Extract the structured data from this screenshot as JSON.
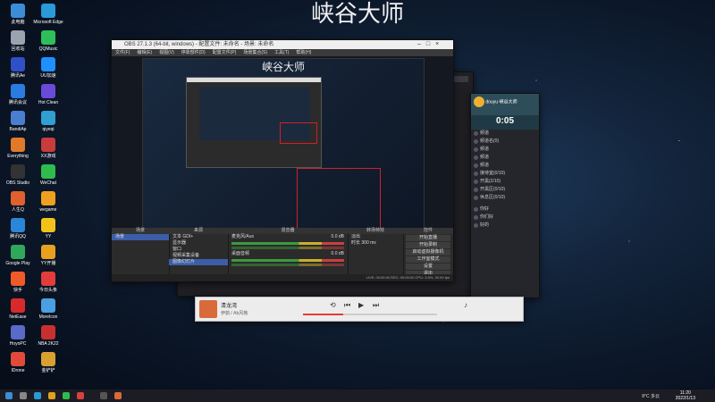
{
  "desktop_title": "峡谷大师",
  "desktop_icons": [
    {
      "label": "此电脑",
      "color": "#3c8dd8"
    },
    {
      "label": "Microsoft Edge",
      "color": "#2a9ad8"
    },
    {
      "label": "回收站",
      "color": "#9aa4b0"
    },
    {
      "label": "QQMusic",
      "color": "#2fbf5a"
    },
    {
      "label": "腾讯Ae",
      "color": "#3050c8"
    },
    {
      "label": "UU加速",
      "color": "#1e90ff"
    },
    {
      "label": "腾讯会议",
      "color": "#2a7ce0"
    },
    {
      "label": "Hot Clean",
      "color": "#6a4ad8"
    },
    {
      "label": "BandiAp",
      "color": "#4a7fd0"
    },
    {
      "label": "qiyeqi",
      "color": "#30a0d0"
    },
    {
      "label": "Everything",
      "color": "#e07a2a"
    },
    {
      "label": "XX游戏",
      "color": "#c83c3c"
    },
    {
      "label": "OBS Studio",
      "color": "#333333"
    },
    {
      "label": "WeChat",
      "color": "#2ebc4f"
    },
    {
      "label": "人生Q",
      "color": "#e06030"
    },
    {
      "label": "wegame",
      "color": "#f0a020"
    },
    {
      "label": "腾讯QQ",
      "color": "#2a86d8"
    },
    {
      "label": "YY",
      "color": "#f2c21b"
    },
    {
      "label": "Google Play",
      "color": "#2fa85a"
    },
    {
      "label": "YY开播",
      "color": "#e8a020"
    },
    {
      "label": "快手",
      "color": "#f05a28"
    },
    {
      "label": "今日头条",
      "color": "#e23c3c"
    },
    {
      "label": "NetEase",
      "color": "#d82a2a"
    },
    {
      "label": "MoreIcon",
      "color": "#4aa0e0"
    },
    {
      "label": "HoyoPC",
      "color": "#5a6ac8"
    },
    {
      "label": "NBA 2K22",
      "color": "#c83030"
    },
    {
      "label": "IDrone",
      "color": "#e04a3a"
    },
    {
      "label": "金铲铲",
      "color": "#d8a030"
    }
  ],
  "obs": {
    "title": "OBS 27.1.3 (64-bit, windows) - 配置文件: 未命名 - 场景: 未命名",
    "menu": [
      "文件(F)",
      "编辑(E)",
      "视图(V)",
      "停靠部件(D)",
      "配置文件(P)",
      "场景集合(S)",
      "工具(T)",
      "帮助(H)"
    ],
    "tabs": [
      "游戏捕获",
      "属性",
      "滤镜"
    ],
    "scene_title": "峡谷大师",
    "scenes_header": "场景",
    "scenes": [
      "场景"
    ],
    "sources_header": "来源",
    "sources": [
      "文本 GDI+",
      "显示器",
      "窗口",
      "视频采集设备",
      "图像幻灯片"
    ],
    "mixer_header": "混音器",
    "mixer": [
      {
        "name": "麦克风/Aux",
        "db": "0.0 dB"
      },
      {
        "name": "桌面音频",
        "db": "0.0 dB"
      }
    ],
    "transitions_header": "转场特效",
    "transition": "淡出",
    "duration_label": "时长",
    "duration": "300 ms",
    "controls_header": "控件",
    "controls": [
      "开始直播",
      "开始录制",
      "启动虚拟摄像机",
      "工作室模式",
      "设置",
      "退出"
    ],
    "status": "LIVE: 00:00:00   REC: 00:00:00   CPU: 3.5%, 30.00 fps"
  },
  "chat": {
    "user": "douyu·峡谷大师",
    "timer": "0:05",
    "channels": [
      "频道",
      "频道名(0)",
      "频道",
      "频道",
      "频道",
      "接待室(0/10)",
      "开黑(2/10)",
      "开黑区(0/10)",
      "休息区(0/10)"
    ],
    "messages": [
      "你好",
      "你们好",
      "好的"
    ]
  },
  "player": {
    "song": "清龙湾",
    "artist": "伊茹 / Ab风格",
    "progress": 0.3
  },
  "taskbar": {
    "weather": "8°C 多云",
    "time": "11:20",
    "date": "2022/1/13"
  }
}
